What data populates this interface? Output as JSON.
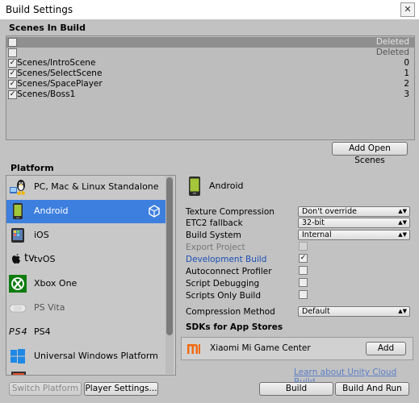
{
  "window": {
    "title": "Build Settings",
    "close_glyph": "✕"
  },
  "scenes": {
    "header": "Scenes In Build",
    "rows": [
      {
        "name": "",
        "index": "Deleted",
        "checked": false
      },
      {
        "name": "",
        "index": "Deleted",
        "checked": false
      },
      {
        "name": "Scenes/IntroScene",
        "index": "0",
        "checked": true
      },
      {
        "name": "Scenes/SelectScene",
        "index": "1",
        "checked": true
      },
      {
        "name": "Scenes/SpacePlayer",
        "index": "2",
        "checked": true
      },
      {
        "name": "Scenes/Boss1",
        "index": "3",
        "checked": true
      }
    ],
    "add_open_scenes": "Add Open Scenes"
  },
  "platform": {
    "header": "Platform",
    "items": [
      {
        "label": "PC, Mac & Linux Standalone",
        "icon": "pc-standalone-icon"
      },
      {
        "label": "Android",
        "icon": "android-icon"
      },
      {
        "label": "iOS",
        "icon": "ios-icon"
      },
      {
        "label": "tvOS",
        "icon": "tvos-icon",
        "prefix": "tv"
      },
      {
        "label": "Xbox One",
        "icon": "xbox-icon"
      },
      {
        "label": "PS Vita",
        "icon": "ps-vita-icon"
      },
      {
        "label": "PS4",
        "icon": "ps4-icon",
        "prefix": "PS4"
      },
      {
        "label": "Universal Windows Platform",
        "icon": "windows-icon"
      }
    ],
    "selected": "Android"
  },
  "details": {
    "title": "Android",
    "settings": {
      "texture_compression": {
        "label": "Texture Compression",
        "value": "Don't override"
      },
      "etc2_fallback": {
        "label": "ETC2 fallback",
        "value": "32-bit"
      },
      "build_system": {
        "label": "Build System",
        "value": "Internal"
      },
      "export_project": {
        "label": "Export Project",
        "checked": false
      },
      "development_build": {
        "label": "Development Build",
        "checked": true
      },
      "autoconnect_profiler": {
        "label": "Autoconnect Profiler",
        "checked": false
      },
      "script_debugging": {
        "label": "Script Debugging",
        "checked": false
      },
      "scripts_only_build": {
        "label": "Scripts Only Build",
        "checked": false
      },
      "compression_method": {
        "label": "Compression Method",
        "value": "Default"
      }
    },
    "sdk": {
      "header": "SDKs for App Stores",
      "item": "Xiaomi Mi Game Center",
      "add_label": "Add"
    },
    "cloud_link": "Learn about Unity Cloud Build"
  },
  "footer": {
    "switch_platform": "Switch Platform",
    "player_settings": "Player Settings...",
    "build": "Build",
    "build_and_run": "Build And Run"
  },
  "colors": {
    "selection": "#3d7fde",
    "link": "#5b7fc7",
    "development_blue": "#1b4fb4",
    "background": "#c2c2c2"
  }
}
